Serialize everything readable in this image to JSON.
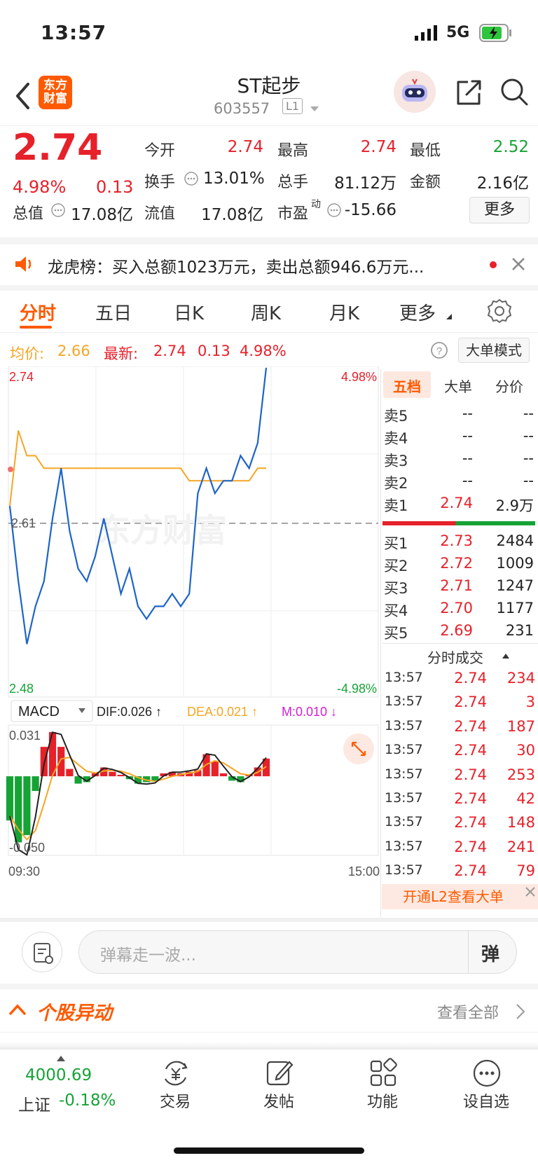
{
  "status_bar": {
    "time": "13:57",
    "network": "5G"
  },
  "header": {
    "title": "ST起步",
    "code": "603557",
    "level": "L1",
    "logo_text": [
      "东方",
      "财富"
    ]
  },
  "quote": {
    "price": "2.74",
    "change_pct": "4.98%",
    "change": "0.13",
    "fields": {
      "open_label": "今开",
      "open": "2.74",
      "high_label": "最高",
      "high": "2.74",
      "low_label": "最低",
      "low": "2.52",
      "turnover_label": "换手",
      "turnover": "13.01%",
      "volume_label": "总手",
      "volume": "81.12万",
      "amount_label": "金额",
      "amount": "2.16亿",
      "mktcap_label": "总值",
      "mktcap": "17.08亿",
      "float_label": "流值",
      "float": "17.08亿",
      "pe_label": "市盈",
      "pe_sup": "动",
      "pe": "-15.66"
    },
    "more_label": "更多"
  },
  "notice": {
    "text": "龙虎榜：买入总额1023万元，卖出总额946.6万元..."
  },
  "tabs": [
    "分时",
    "五日",
    "日K",
    "周K",
    "月K",
    "更多"
  ],
  "info_line": {
    "avg_label": "均价:",
    "avg": "2.66",
    "latest_label": "最新:",
    "latest": "2.74",
    "change": "0.13",
    "pct": "4.98%",
    "big_order_label": "大单模式"
  },
  "chart_data": [
    {
      "type": "line",
      "series": [
        {
          "values": [
            2.63,
            2.57,
            2.52,
            2.55,
            2.57,
            2.62,
            2.66,
            2.61,
            2.58,
            2.57,
            2.59,
            2.62,
            2.59,
            2.56,
            2.58,
            2.55,
            2.54,
            2.55,
            2.55,
            2.56,
            2.55,
            2.56,
            2.64,
            2.66,
            2.64,
            2.65,
            2.65,
            2.67,
            2.66,
            2.68,
            2.74
          ]
        },
        {
          "values": [
            2.63,
            2.69,
            2.67,
            2.67,
            2.66,
            2.66,
            2.66,
            2.66,
            2.66,
            2.66,
            2.66,
            2.66,
            2.66,
            2.66,
            2.66,
            2.66,
            2.66,
            2.66,
            2.66,
            2.66,
            2.66,
            2.65,
            2.65,
            2.65,
            2.65,
            2.65,
            2.65,
            2.65,
            2.65,
            2.66,
            2.66
          ]
        }
      ],
      "ylim": [
        2.48,
        2.74
      ],
      "ytick_labels": [
        "2.74",
        "2.61",
        "2.48"
      ],
      "pct_labels": [
        "4.98%",
        "-4.98%"
      ],
      "xtick_labels": [
        "09:30",
        "15:00"
      ]
    },
    {
      "type": "bar",
      "title": "MACD",
      "legend": {
        "dif": "DIF:0.026 ↑",
        "dea": "DEA:0.021 ↑",
        "m": "M:0.010 ↓"
      },
      "ylim": [
        -0.05,
        0.031
      ],
      "ytick_labels": [
        "0.031",
        "-0.050"
      ],
      "values": [
        -0.03,
        -0.045,
        -0.04,
        -0.01,
        0.02,
        0.03,
        0.02,
        0.005,
        -0.005,
        -0.004,
        0.002,
        0.006,
        0.003,
        0.001,
        -0.002,
        -0.005,
        -0.004,
        -0.003,
        0.002,
        0.003,
        0.002,
        0.003,
        0.004,
        0.015,
        0.01,
        0.002,
        -0.003,
        -0.004,
        0.001,
        0.006,
        0.012
      ]
    }
  ],
  "orderbook": {
    "tabs": [
      "五档",
      "大单",
      "分价"
    ],
    "asks": [
      {
        "label": "卖5",
        "price": "--",
        "vol": "--"
      },
      {
        "label": "卖4",
        "price": "--",
        "vol": "--"
      },
      {
        "label": "卖3",
        "price": "--",
        "vol": "--"
      },
      {
        "label": "卖2",
        "price": "--",
        "vol": "--"
      },
      {
        "label": "卖1",
        "price": "2.74",
        "vol": "2.9万"
      }
    ],
    "bids": [
      {
        "label": "买1",
        "price": "2.73",
        "vol": "2484"
      },
      {
        "label": "买2",
        "price": "2.72",
        "vol": "1009"
      },
      {
        "label": "买3",
        "price": "2.71",
        "vol": "1247"
      },
      {
        "label": "买4",
        "price": "2.70",
        "vol": "1177"
      },
      {
        "label": "买5",
        "price": "2.69",
        "vol": "231"
      }
    ],
    "trades_title": "分时成交",
    "trades": [
      {
        "time": "13:57",
        "price": "2.74",
        "vol": "234"
      },
      {
        "time": "13:57",
        "price": "2.74",
        "vol": "3"
      },
      {
        "time": "13:57",
        "price": "2.74",
        "vol": "187"
      },
      {
        "time": "13:57",
        "price": "2.74",
        "vol": "30"
      },
      {
        "time": "13:57",
        "price": "2.74",
        "vol": "253"
      },
      {
        "time": "13:57",
        "price": "2.74",
        "vol": "42"
      },
      {
        "time": "13:57",
        "price": "2.74",
        "vol": "148"
      },
      {
        "time": "13:57",
        "price": "2.74",
        "vol": "241"
      },
      {
        "time": "13:57",
        "price": "2.74",
        "vol": "79"
      }
    ],
    "l2_banner": "开通L2查看大单"
  },
  "comment_bar": {
    "placeholder": "弹幕走一波...",
    "danmu_label": "弹"
  },
  "movement_section": {
    "title": "个股异动",
    "view_all": "查看全部"
  },
  "bottom_nav": {
    "index_value": "4000.69",
    "index_name": "上证",
    "index_pct": "-0.18%",
    "items": [
      "交易",
      "发帖",
      "功能",
      "设自选"
    ]
  },
  "watermark": "东方财富",
  "colors": {
    "up": "#e6212a",
    "down": "#16a336",
    "accent": "#ff5a00",
    "price_line": "#1e64c8",
    "avg_line": "#f5a623"
  }
}
